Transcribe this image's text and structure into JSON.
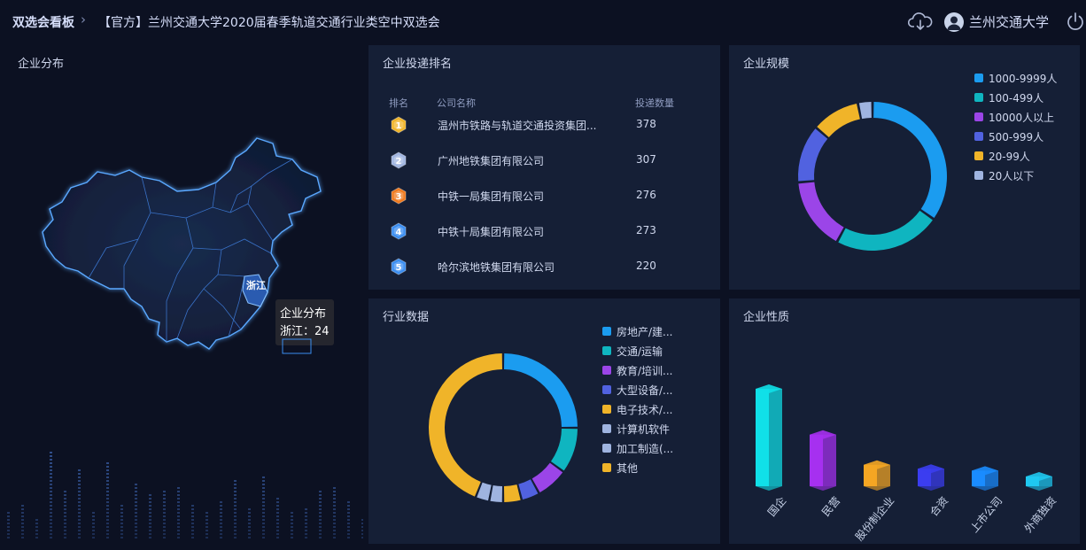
{
  "header": {
    "breadcrumb_root": "双选会看板",
    "breadcrumb_sep": "›",
    "breadcrumb_current": "【官方】兰州交通大学2020届春季轨道交通行业类空中双选会",
    "user_name": "兰州交通大学",
    "icons": [
      "cloud-download-icon",
      "user-avatar-icon",
      "power-icon"
    ]
  },
  "map_panel": {
    "title": "企业分布",
    "highlight_region": "浙江",
    "tooltip_title": "企业分布",
    "tooltip_value": "浙江：24"
  },
  "ranking_panel": {
    "title": "企业投递排名",
    "columns": [
      "排名",
      "公司名称",
      "投递数量"
    ],
    "rows": [
      {
        "rank": "1",
        "name": "温州市铁路与轨道交通投资集团...",
        "count": "378",
        "medal_color": "#f0b429"
      },
      {
        "rank": "2",
        "name": "广州地铁集团有限公司",
        "count": "307",
        "medal_color": "#9fb4e0"
      },
      {
        "rank": "3",
        "name": "中铁一局集团有限公司",
        "count": "276",
        "medal_color": "#f07a1e"
      },
      {
        "rank": "4",
        "name": "中铁十局集团有限公司",
        "count": "273",
        "medal_color": "#3a8df0"
      },
      {
        "rank": "5",
        "name": "哈尔滨地铁集团有限公司",
        "count": "220",
        "medal_color": "#3a8df0"
      }
    ]
  },
  "scale_panel": {
    "title": "企业规模",
    "chart_data": {
      "type": "pie",
      "donut": true,
      "legend_position": "top-right",
      "categories": [
        "1000-9999人",
        "100-499人",
        "10000人以上",
        "500-999人",
        "20-99人",
        "20人以下"
      ],
      "values": [
        33,
        22,
        15,
        12,
        10,
        3
      ],
      "colors": [
        "#1b9cf0",
        "#0fb5c0",
        "#9b45e8",
        "#5162e0",
        "#f0b429",
        "#9fb4e0"
      ]
    }
  },
  "industry_panel": {
    "title": "行业数据",
    "chart_data": {
      "type": "pie",
      "donut": true,
      "legend_position": "right",
      "categories": [
        "房地产/建...",
        "交通/运输",
        "教育/培训...",
        "大型设备/...",
        "电子技术/...",
        "计算机软件",
        "加工制造(...",
        "其他"
      ],
      "values": [
        25,
        10,
        7,
        4,
        4,
        3,
        3,
        44
      ],
      "colors": [
        "#1b9cf0",
        "#0fb5c0",
        "#9b45e8",
        "#5162e0",
        "#f0b429",
        "#9fb4e0",
        "#9fb4e0",
        "#f0b429"
      ]
    }
  },
  "nature_panel": {
    "title": "企业性质",
    "chart_data": {
      "type": "bar",
      "categories": [
        "国企",
        "民营",
        "股份制企业",
        "合资",
        "上市公司",
        "外商独资"
      ],
      "values": [
        100,
        53,
        22,
        18,
        16,
        10
      ],
      "colors": [
        "#10e0e8",
        "#a630f0",
        "#f5a623",
        "#3b3df0",
        "#1a8cff",
        "#1fc8f0"
      ]
    }
  }
}
